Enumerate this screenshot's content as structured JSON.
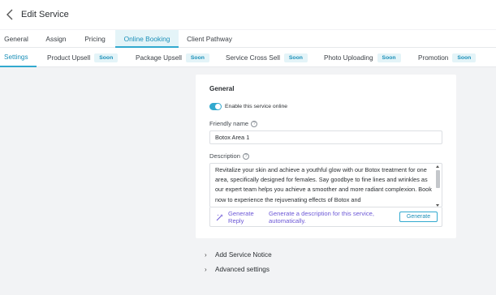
{
  "header": {
    "title": "Edit Service",
    "back_icon": "chevron-left-icon"
  },
  "tabs": [
    {
      "label": "General"
    },
    {
      "label": "Assign"
    },
    {
      "label": "Pricing"
    },
    {
      "label": "Online Booking",
      "active": true
    },
    {
      "label": "Client Pathway"
    }
  ],
  "subtabs": [
    {
      "label": "Settings",
      "active": true
    },
    {
      "label": "Product Upsell",
      "badge": "Soon"
    },
    {
      "label": "Package Upsell",
      "badge": "Soon"
    },
    {
      "label": "Service Cross Sell",
      "badge": "Soon"
    },
    {
      "label": "Photo Uploading",
      "badge": "Soon"
    },
    {
      "label": "Promotion",
      "badge": "Soon"
    }
  ],
  "general": {
    "title": "General",
    "enable_online": {
      "label": "Enable this service online",
      "checked": true
    },
    "friendly_name": {
      "label": "Friendly name",
      "value": "Botox Area 1"
    },
    "description": {
      "label": "Description",
      "value": "Revitalize your skin and achieve a youthful glow with our Botox treatment for one area, specifically designed for females. Say goodbye to fine lines and wrinkles as our expert team helps you achieve a smoother and more radiant complexion. Book now to experience the rejuvenating effects of Botox and"
    },
    "generate": {
      "reply_label": "Generate Reply",
      "description": "Generate a description for this service, automatically.",
      "button_label": "Generate",
      "icon": "sparkle-icon"
    }
  },
  "sections": {
    "service_notice": "Add Service Notice",
    "advanced": "Advanced settings"
  },
  "colors": {
    "accent": "#32a9cf",
    "ai_purple": "#6c58d6",
    "background": "#f2f3f5"
  }
}
